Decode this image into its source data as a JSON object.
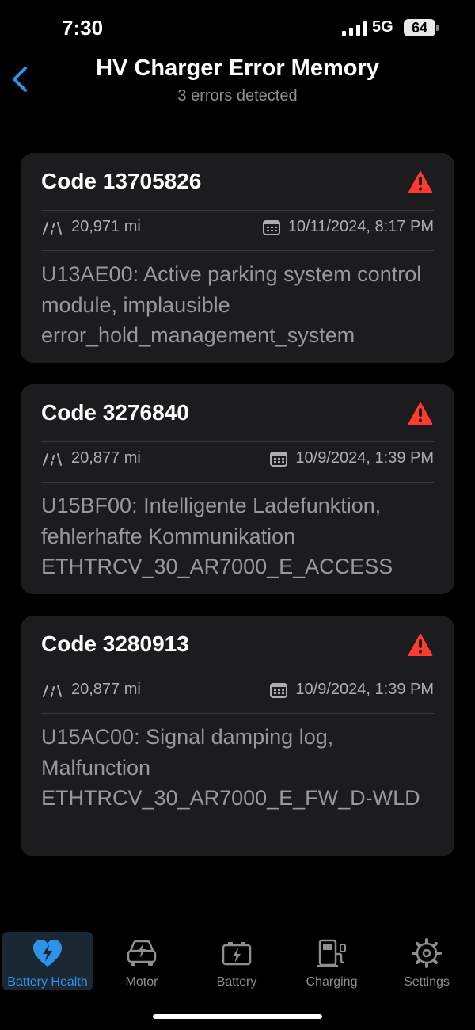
{
  "status_bar": {
    "time": "7:30",
    "network": "5G",
    "battery": "64"
  },
  "header": {
    "title": "HV Charger Error Memory",
    "subtitle": "3 errors detected"
  },
  "errors": [
    {
      "code": "Code 13705826",
      "mileage": "20,971 mi",
      "datetime": "10/11/2024, 8:17 PM",
      "description": "U13AE00: Active parking system control module, implausible error_hold_management_system"
    },
    {
      "code": "Code 3276840",
      "mileage": "20,877 mi",
      "datetime": "10/9/2024, 1:39 PM",
      "description": "U15BF00: Intelligente Ladefunktion, fehlerhafte Kommunikation ETHTRCV_30_AR7000_E_ACCESS"
    },
    {
      "code": "Code 3280913",
      "mileage": "20,877 mi",
      "datetime": "10/9/2024, 1:39 PM",
      "description": "U15AC00: Signal damping log, Malfunction ETHTRCV_30_AR7000_E_FW_D-WLD"
    }
  ],
  "tabs": [
    {
      "label": "Battery Health",
      "icon": "heart-bolt-icon",
      "active": true
    },
    {
      "label": "Motor",
      "icon": "car-bolt-icon",
      "active": false
    },
    {
      "label": "Battery",
      "icon": "battery-bolt-icon",
      "active": false
    },
    {
      "label": "Charging",
      "icon": "charging-station-icon",
      "active": false
    },
    {
      "label": "Settings",
      "icon": "gear-icon",
      "active": false
    }
  ],
  "colors": {
    "accent": "#2e93e6",
    "warning": "#ff3b30",
    "card": "#1c1c1e",
    "background": "#000000"
  }
}
